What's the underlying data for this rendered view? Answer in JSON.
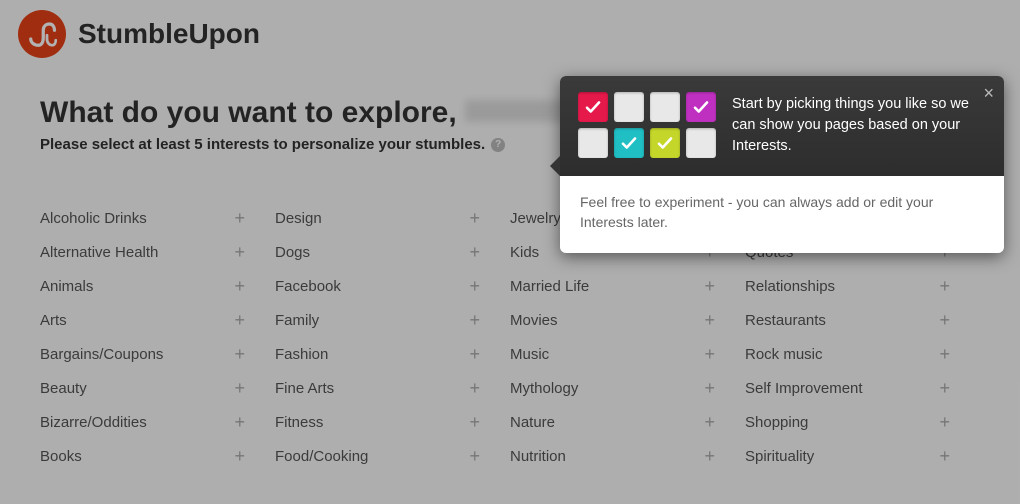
{
  "brand": "StumbleUpon",
  "heading_prefix": "What do you want to explore, ",
  "subhead": "Please select at least 5 interests to personalize your stumbles.",
  "interests": {
    "col1": [
      "Alcoholic Drinks",
      "Alternative Health",
      "Animals",
      "Arts",
      "Bargains/Coupons",
      "Beauty",
      "Bizarre/Oddities",
      "Books"
    ],
    "col2": [
      "Design",
      "Dogs",
      "Facebook",
      "Family",
      "Fashion",
      "Fine Arts",
      "Fitness",
      "Food/Cooking"
    ],
    "col3": [
      "Jewelry",
      "Kids",
      "Married Life",
      "Movies",
      "Music",
      "Mythology",
      "Nature",
      "Nutrition"
    ],
    "col4": [
      "",
      "Quotes",
      "Relationships",
      "Restaurants",
      "Rock music",
      "Self Improvement",
      "Shopping",
      "Spirituality"
    ]
  },
  "popover": {
    "top_text": "Start by picking things you like so we can show you pages based on your Interests.",
    "bottom_text": "Feel free to experiment - you can always add or edit your Interests later.",
    "boxes": [
      {
        "color": "red",
        "checked": true
      },
      {
        "color": "",
        "checked": false
      },
      {
        "color": "",
        "checked": false
      },
      {
        "color": "magenta",
        "checked": true
      },
      {
        "color": "",
        "checked": false
      },
      {
        "color": "teal",
        "checked": true
      },
      {
        "color": "lime",
        "checked": true
      },
      {
        "color": "",
        "checked": false
      }
    ]
  }
}
